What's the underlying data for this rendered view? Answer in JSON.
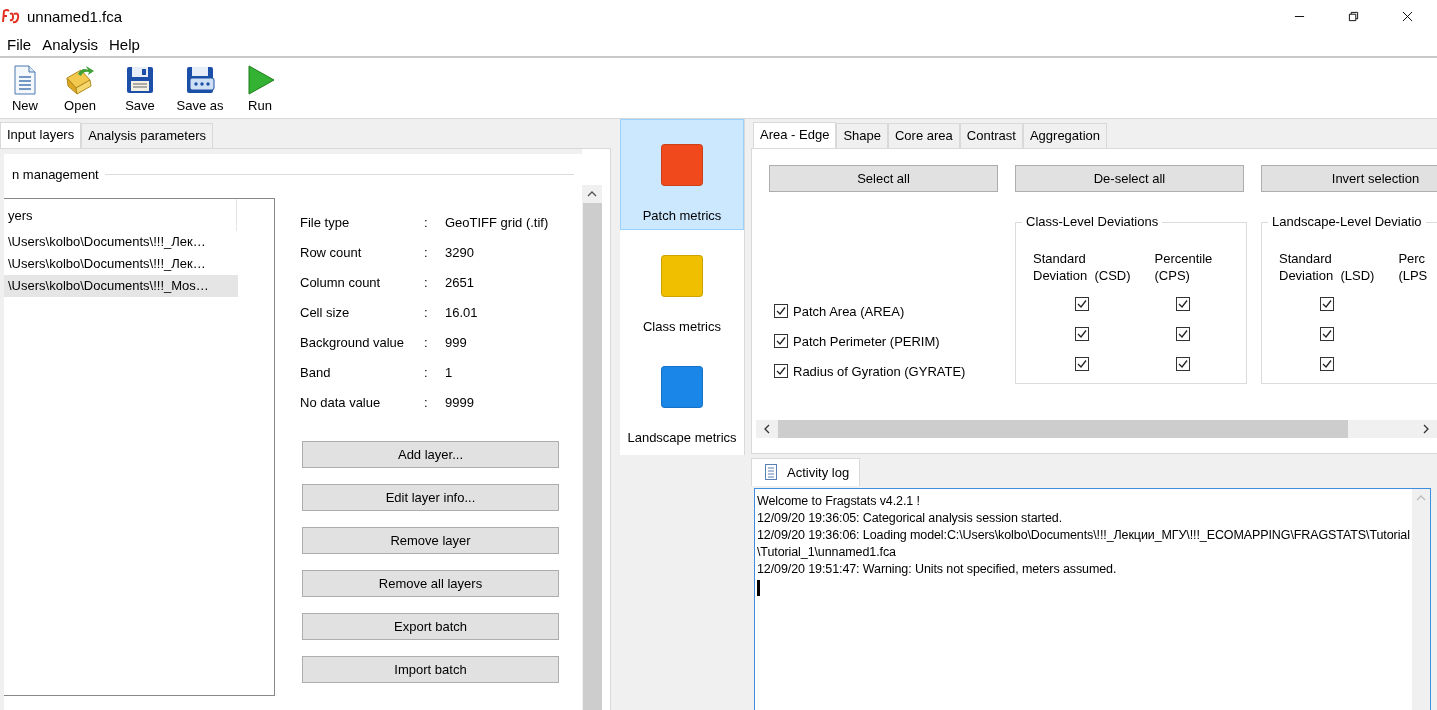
{
  "window": {
    "title": "unnamed1.fca"
  },
  "menu": [
    "File",
    "Analysis",
    "Help"
  ],
  "toolbar": [
    {
      "label": "New",
      "kind": "new"
    },
    {
      "label": "Open",
      "kind": "open"
    },
    {
      "label": "Save",
      "kind": "save"
    },
    {
      "label": "Save as",
      "kind": "saveas"
    },
    {
      "label": "Run",
      "kind": "run"
    }
  ],
  "left_tabs": [
    {
      "label": "Input layers",
      "selected": true
    },
    {
      "label": "Analysis parameters",
      "selected": false
    }
  ],
  "data_management": {
    "title": "n management",
    "layers_header": "yers",
    "layers": [
      {
        "path": "\\Users\\kolbo\\Documents\\!!!_Лек…",
        "selected": false
      },
      {
        "path": "\\Users\\kolbo\\Documents\\!!!_Лек…",
        "selected": false
      },
      {
        "path": "\\Users\\kolbo\\Documents\\!!!_Mos…",
        "selected": true
      }
    ],
    "properties": [
      {
        "label": "File type",
        "separator": ":",
        "value": "GeoTIFF grid (.tif)"
      },
      {
        "label": "Row count",
        "separator": ":",
        "value": "3290"
      },
      {
        "label": "Column count",
        "separator": ":",
        "value": "2651"
      },
      {
        "label": "Cell size",
        "separator": ":",
        "value": "16.01"
      },
      {
        "label": "Background value",
        "separator": ":",
        "value": "999"
      },
      {
        "label": "Band",
        "separator": ":",
        "value": "1"
      },
      {
        "label": "No data value",
        "separator": ":",
        "value": "9999"
      }
    ],
    "buttons": [
      "Add layer...",
      "Edit layer info...",
      "Remove layer",
      "Remove all layers",
      "Export batch",
      "Import batch"
    ]
  },
  "metric_groups": [
    {
      "label": "Patch metrics",
      "selected": true,
      "color": "#f04a1c"
    },
    {
      "label": "Class metrics",
      "selected": false,
      "color": "#f0c000"
    },
    {
      "label": "Landscape metrics",
      "selected": false,
      "color": "#1a86e8"
    }
  ],
  "metric_tabs": [
    {
      "label": "Area - Edge",
      "selected": true
    },
    {
      "label": "Shape",
      "selected": false
    },
    {
      "label": "Core area",
      "selected": false
    },
    {
      "label": "Contrast",
      "selected": false
    },
    {
      "label": "Aggregation",
      "selected": false
    }
  ],
  "selection_buttons": [
    "Select all",
    "De-select all",
    "Invert selection"
  ],
  "class_deviations": {
    "title": "Class-Level Deviations",
    "columns": [
      "Standard\nDeviation  (CSD)",
      "Percentile\n(CPS)"
    ]
  },
  "landscape_deviations": {
    "title": "Landscape-Level Deviatio",
    "columns": [
      "Standard\nDeviation  (LSD)",
      "Perc\n(LPS"
    ]
  },
  "metrics": [
    {
      "label": "Patch Area  (AREA)",
      "checked": true,
      "csd": true,
      "cps": true,
      "lsd": true
    },
    {
      "label": "Patch Perimeter  (PERIM)",
      "checked": true,
      "csd": true,
      "cps": true,
      "lsd": true
    },
    {
      "label": "Radius of Gyration  (GYRATE)",
      "checked": true,
      "csd": true,
      "cps": true,
      "lsd": true
    }
  ],
  "activity_log": {
    "tab": "Activity log",
    "lines": [
      "Welcome to Fragstats v4.2.1 !",
      "12/09/20 19:36:05: Categorical analysis session started.",
      "12/09/20 19:36:06: Loading model:C:\\Users\\kolbo\\Documents\\!!!_Лекции_МГУ\\!!!_ECOMAPPING\\FRAGSTATS\\Tutorial",
      "\\Tutorial_1\\unnamed1.fca",
      "12/09/20 19:51:47: Warning: Units not specified, meters assumed."
    ]
  }
}
